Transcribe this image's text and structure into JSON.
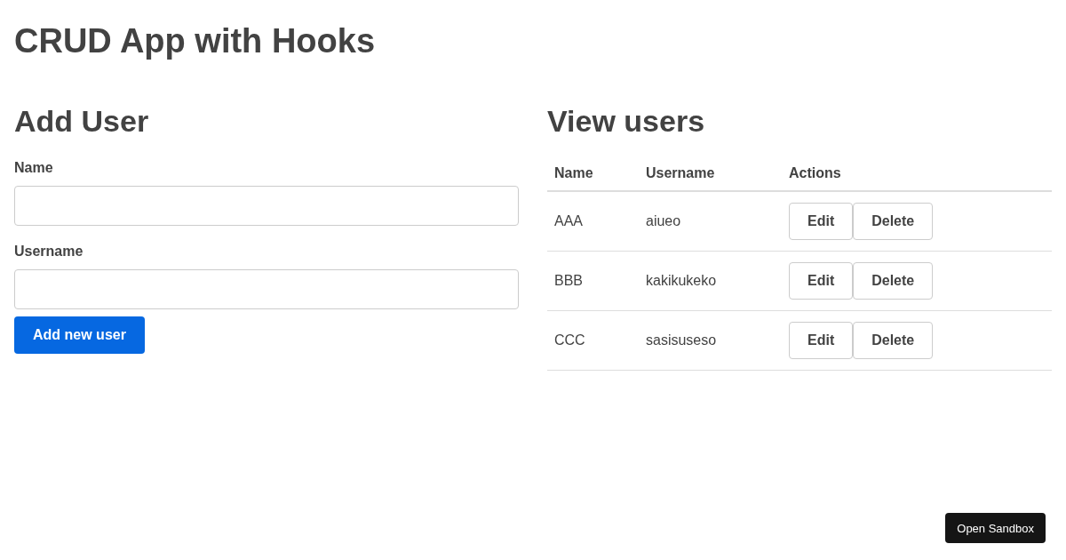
{
  "title": "CRUD App with Hooks",
  "add_user": {
    "heading": "Add User",
    "fields": [
      {
        "label": "Name"
      },
      {
        "label": "Username"
      }
    ],
    "submit": "Add new user"
  },
  "view_users": {
    "heading": "View users",
    "columns": [
      "Name",
      "Username",
      "Actions"
    ],
    "rows": [
      {
        "name": "AAA",
        "username": "aiueo",
        "actions": [
          "Edit",
          "Delete"
        ]
      },
      {
        "name": "BBB",
        "username": "kakikukeko",
        "actions": [
          "Edit",
          "Delete"
        ]
      },
      {
        "name": "CCC",
        "username": "sasisuseso",
        "actions": [
          "Edit",
          "Delete"
        ]
      }
    ]
  },
  "sandbox_button": "Open Sandbox"
}
